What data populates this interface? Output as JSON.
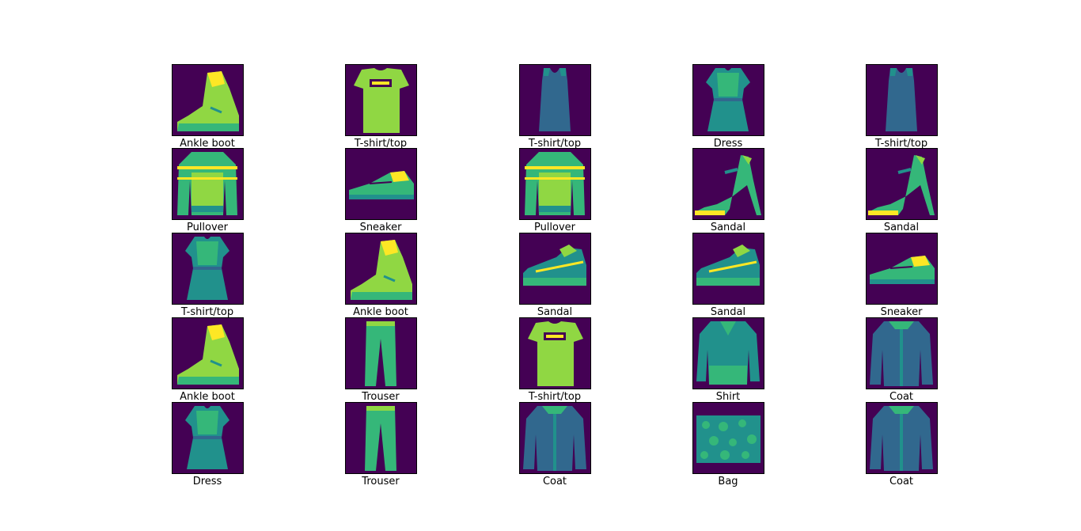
{
  "palette": {
    "background": "#440154",
    "dark": "#31688e",
    "mid": "#21918c",
    "light": "#35b779",
    "bright": "#90d743",
    "max": "#fde725"
  },
  "items": [
    {
      "label": "Ankle boot",
      "icon": "ankle-boot-icon"
    },
    {
      "label": "T-shirt/top",
      "icon": "tshirt-icon"
    },
    {
      "label": "T-shirt/top",
      "icon": "tank-top-icon"
    },
    {
      "label": "Dress",
      "icon": "dress-icon"
    },
    {
      "label": "T-shirt/top",
      "icon": "tank-top-icon"
    },
    {
      "label": "Pullover",
      "icon": "pullover-icon"
    },
    {
      "label": "Sneaker",
      "icon": "sneaker-icon"
    },
    {
      "label": "Pullover",
      "icon": "pullover-icon"
    },
    {
      "label": "Sandal",
      "icon": "sandal-heel-icon"
    },
    {
      "label": "Sandal",
      "icon": "sandal-heel-icon"
    },
    {
      "label": "T-shirt/top",
      "icon": "dress-icon"
    },
    {
      "label": "Ankle boot",
      "icon": "ankle-boot-icon"
    },
    {
      "label": "Sandal",
      "icon": "sandal-flat-icon"
    },
    {
      "label": "Sandal",
      "icon": "sandal-flat-icon"
    },
    {
      "label": "Sneaker",
      "icon": "sneaker-icon"
    },
    {
      "label": "Ankle boot",
      "icon": "ankle-boot-icon"
    },
    {
      "label": "Trouser",
      "icon": "trouser-icon"
    },
    {
      "label": "T-shirt/top",
      "icon": "tshirt-icon"
    },
    {
      "label": "Shirt",
      "icon": "shirt-icon"
    },
    {
      "label": "Coat",
      "icon": "coat-icon"
    },
    {
      "label": "Dress",
      "icon": "dress-icon"
    },
    {
      "label": "Trouser",
      "icon": "trouser-icon"
    },
    {
      "label": "Coat",
      "icon": "coat-icon"
    },
    {
      "label": "Bag",
      "icon": "bag-icon"
    },
    {
      "label": "Coat",
      "icon": "coat-icon"
    }
  ]
}
